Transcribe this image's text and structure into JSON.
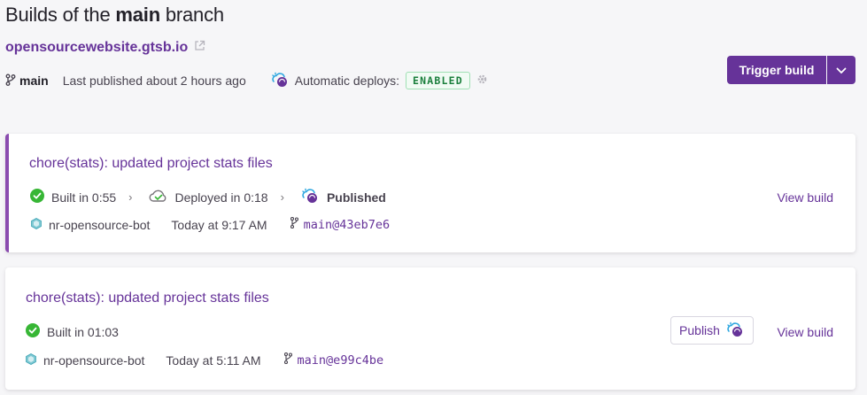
{
  "header": {
    "title_prefix": "Builds of the ",
    "title_branch": "main",
    "title_suffix": " branch",
    "site_url": "opensourcewebsite.gtsb.io",
    "branch": "main",
    "last_published": "Last published about 2 hours ago",
    "auto_deploys_label": "Automatic deploys:",
    "auto_deploys_status": "ENABLED",
    "trigger_build_label": "Trigger build"
  },
  "colors": {
    "accent": "#663399",
    "active_border": "#8a4baf",
    "success": "#37b635",
    "badge_text": "#1a7f3c"
  },
  "builds": [
    {
      "title": "chore(stats): updated project stats files",
      "built": "Built in 0:55",
      "deployed": "Deployed in 0:18",
      "published": "Published",
      "author": "nr-opensource-bot",
      "time": "Today at 9:17 AM",
      "commit": "main@43eb7e6",
      "view_build_label": "View build"
    },
    {
      "title": "chore(stats): updated project stats files",
      "built": "Built in 01:03",
      "author": "nr-opensource-bot",
      "time": "Today at 5:11 AM",
      "commit": "main@e99c4be",
      "publish_label": "Publish",
      "view_build_label": "View build"
    }
  ],
  "icons": [
    "external-link-icon",
    "branch-icon",
    "auto-deploy-icon",
    "gear-icon",
    "chevron-down-icon",
    "check-circle-icon",
    "chevron-right-icon",
    "cloud-check-icon",
    "publish-icon",
    "bot-avatar-icon",
    "commit-branch-icon"
  ]
}
